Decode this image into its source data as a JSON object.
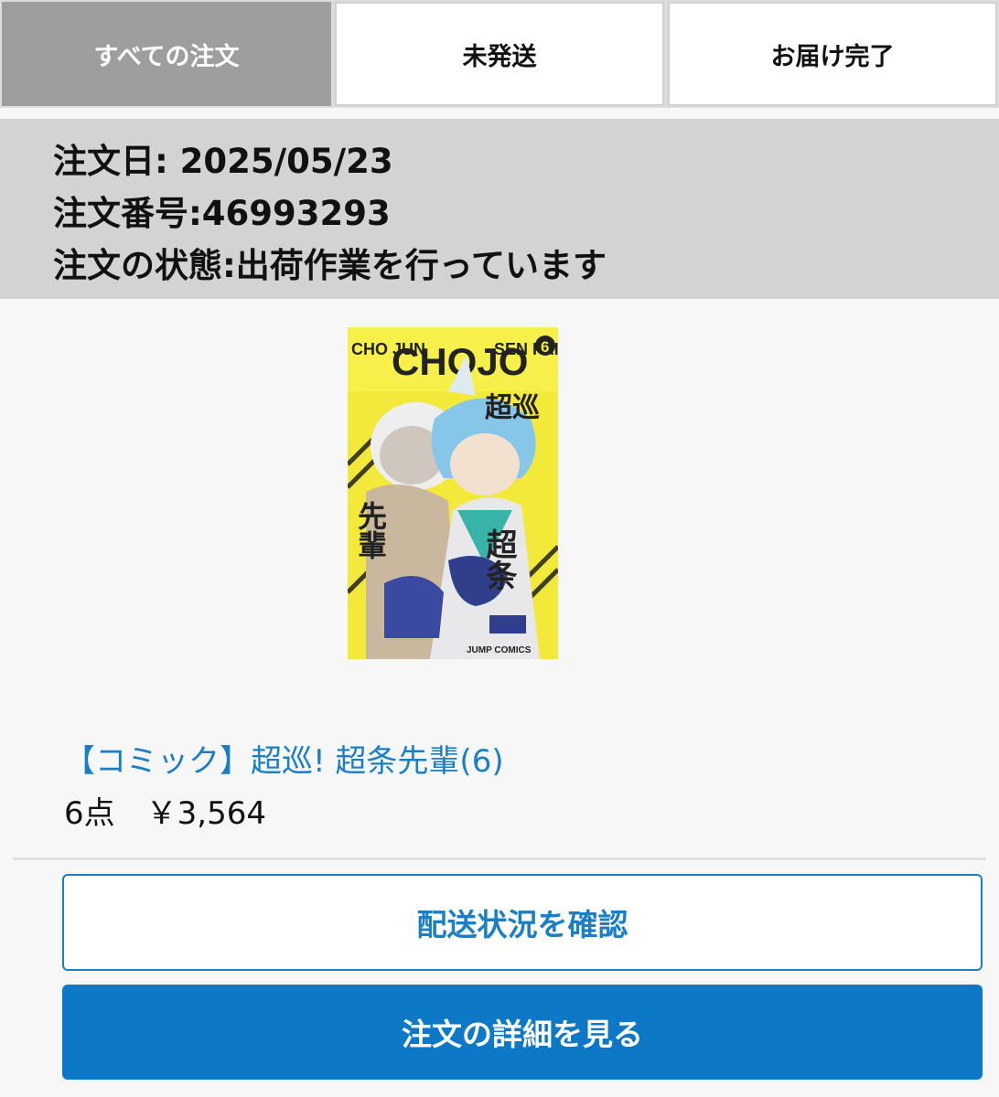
{
  "tabs": [
    {
      "label": "すべての注文",
      "active": true
    },
    {
      "label": "未発送",
      "active": false
    },
    {
      "label": "お届け完了",
      "active": false
    }
  ],
  "order": {
    "date_line": "注文日: 2025/05/23",
    "number_line": "注文番号:46993293",
    "status_line": "注文の状態:出荷作業を行っています"
  },
  "item": {
    "cover_text_top_left": "CHO JUN",
    "cover_text_logo": "CHOJO",
    "cover_text_top_right": "SEN PAI",
    "cover_volume": "6",
    "cover_title_a": "超巡",
    "cover_title_b": "超条",
    "cover_title_c": "先輩",
    "cover_publisher": "JUMP COMICS",
    "title": "【コミック】超巡! 超条先輩(6)",
    "price": "6点　￥3,564"
  },
  "buttons": {
    "track_label": "配送状況を確認",
    "details_label": "注文の詳細を見る"
  },
  "colors": {
    "accent": "#0c78c6",
    "link": "#1a7fc4",
    "active_tab": "#9e9e9e",
    "header_bg": "#d3d3d3"
  }
}
